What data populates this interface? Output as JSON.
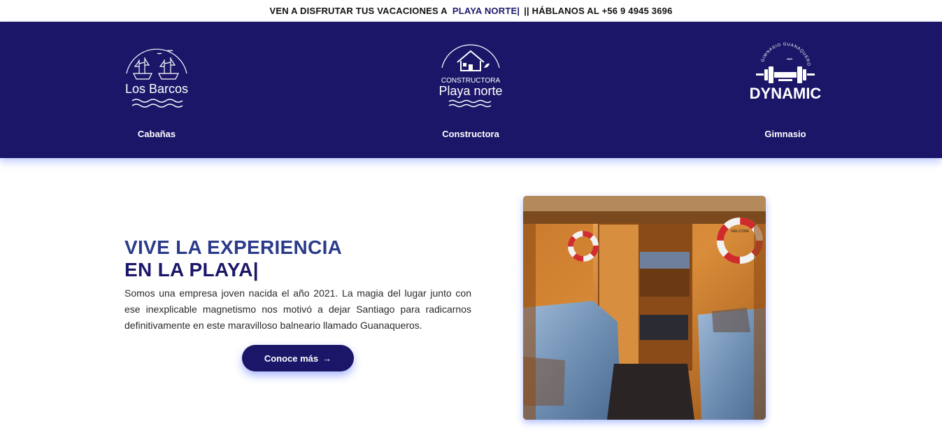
{
  "topbar": {
    "prefix": "VEN A DISFRUTAR TUS VACACIONES A",
    "highlight": "PLAYA NORTE|",
    "suffix": "|| HÁBLANOS AL +56 9 4945 3696"
  },
  "nav": {
    "brands": [
      {
        "logo_text": "Los Barcos",
        "caption": "Cabañas",
        "icon": "ships-icon"
      },
      {
        "logo_top": "CONSTRUCTORA",
        "logo_text": "Playa norte",
        "caption": "Constructora",
        "icon": "house-icon"
      },
      {
        "logo_arc": "GIMNASIO GUANAQUEROS",
        "logo_text": "DYNAMIC",
        "caption": "Gimnasio",
        "icon": "dumbbell-icon"
      }
    ]
  },
  "hero": {
    "title_line1": "VIVE LA EXPERIENCIA",
    "title_line2": "EN LA PLAYA|",
    "description": "Somos una empresa joven nacida el año 2021. La magia del lugar junto con ese inexplicable magnetismo nos motivó a dejar Santiago para radicarnos definitivamente en este maravilloso balneario llamado Guanaqueros.",
    "cta_label": "Conoce más",
    "cta_arrow": "→",
    "photo_plate": "WELCOME"
  },
  "colors": {
    "nav_bg": "#1b1668",
    "title_primary": "#2b3b8a",
    "title_secondary": "#1b1668"
  }
}
